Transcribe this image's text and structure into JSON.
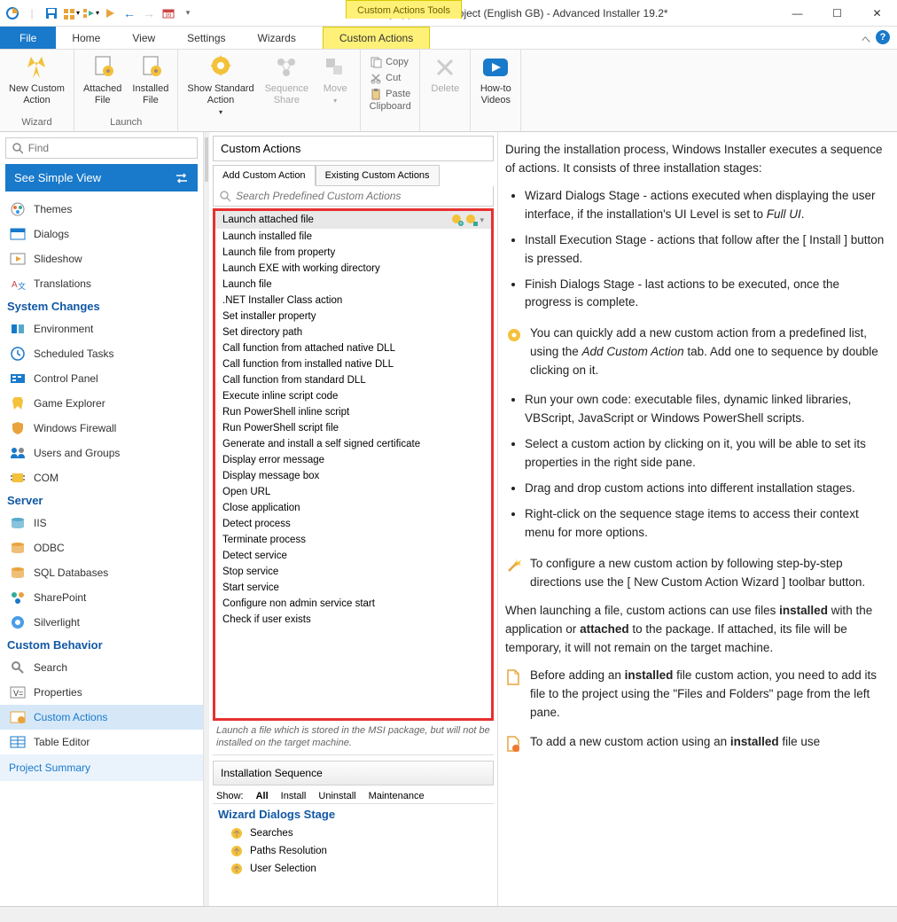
{
  "title": "MyApp - New Project (English GB) - Advanced Installer 19.2*",
  "contextTab": "Custom Actions Tools",
  "menu": {
    "file": "File",
    "home": "Home",
    "view": "View",
    "settings": "Settings",
    "wizards": "Wizards",
    "customActions": "Custom Actions"
  },
  "ribbon": {
    "wizard": {
      "label": "Wizard",
      "newCustom": "New Custom\nAction"
    },
    "launch": {
      "label": "Launch",
      "attached": "Attached\nFile",
      "installed": "Installed\nFile"
    },
    "standard": "Show Standard\nAction",
    "share": "Sequence\nShare",
    "move": "Move",
    "clipboard": {
      "label": "Clipboard",
      "copy": "Copy",
      "cut": "Cut",
      "paste": "Paste"
    },
    "delete": "Delete",
    "videos": "How-to\nVideos"
  },
  "find": {
    "placeholder": "Find"
  },
  "simpleView": "See Simple View",
  "nav": {
    "themes": "Themes",
    "dialogs": "Dialogs",
    "slideshow": "Slideshow",
    "translations": "Translations",
    "sysChanges": "System Changes",
    "environment": "Environment",
    "scheduled": "Scheduled Tasks",
    "controlPanel": "Control Panel",
    "gameExplorer": "Game Explorer",
    "firewall": "Windows Firewall",
    "usersGroups": "Users and Groups",
    "com": "COM",
    "server": "Server",
    "iis": "IIS",
    "odbc": "ODBC",
    "sql": "SQL Databases",
    "sharepoint": "SharePoint",
    "silverlight": "Silverlight",
    "customBehavior": "Custom Behavior",
    "search": "Search",
    "properties": "Properties",
    "customActions": "Custom Actions",
    "tableEditor": "Table Editor",
    "projectSummary": "Project Summary"
  },
  "panelHeader": "Custom Actions",
  "tabs": {
    "add": "Add Custom Action",
    "existing": "Existing Custom Actions"
  },
  "searchPlaceholder": "Search Predefined Custom Actions",
  "actions": [
    "Launch attached file",
    "Launch installed file",
    "Launch file from property",
    "Launch EXE with working directory",
    "Launch file",
    ".NET Installer Class action",
    "Set installer property",
    "Set directory path",
    "Call function from attached native DLL",
    "Call function from installed native DLL",
    "Call function from standard DLL",
    "Execute inline script code",
    "Run PowerShell inline script",
    "Run PowerShell script file",
    "Generate and install a self signed certificate",
    "Display error message",
    "Display message box",
    "Open URL",
    "Close application",
    "Detect process",
    "Terminate process",
    "Detect service",
    "Stop service",
    "Start service",
    "Configure non admin service start",
    "Check if user exists"
  ],
  "desc": "Launch a file which is stored in the MSI package, but will not be installed on the target machine.",
  "sequenceHeader": "Installation Sequence",
  "show": {
    "label": "Show:",
    "all": "All",
    "install": "Install",
    "uninstall": "Uninstall",
    "maintenance": "Maintenance"
  },
  "stage": {
    "header": "Wizard Dialogs Stage",
    "items": [
      "Searches",
      "Paths Resolution",
      "User Selection"
    ]
  },
  "help": {
    "p1": "During the installation process, Windows Installer executes a sequence of actions. It consists of three installation stages:",
    "li1a": "Wizard Dialogs Stage - actions executed when displaying the user interface, if the installation's UI Level is set to ",
    "li1b": "Full UI",
    "li2": "Install Execution Stage - actions that follow after the [ Install ] button is pressed.",
    "li3": "Finish Dialogs Stage - last actions to be executed, once the progress is complete.",
    "tip1a": "You can quickly add a new custom action from a predefined list, using the ",
    "tip1b": "Add Custom Action",
    "tip1c": " tab. Add one to sequence by double clicking on it.",
    "li4": "Run your own code: executable files, dynamic linked libraries, VBScript, JavaScript or Windows PowerShell scripts.",
    "li5": "Select a custom action by clicking on it, you will be able to set its properties in the right side pane.",
    "li6": "Drag and drop custom actions into different installation stages.",
    "li7": "Right-click on the sequence stage items to access their context menu for more options.",
    "tip2": "To configure a new custom action by following step-by-step directions use the [ New Custom Action Wizard ] toolbar button.",
    "p2a": "When launching a file, custom actions can use files ",
    "p2b": "installed",
    "p2c": " with the application or ",
    "p2d": "attached",
    "p2e": " to the package. If attached, its file will be temporary, it will not remain on the target machine.",
    "tip3a": "Before adding an ",
    "tip3b": "installed",
    "tip3c": " file custom action, you need to add its file to the project using the \"Files and Folders\" page from the left pane.",
    "tip4a": "To add a new custom action using an ",
    "tip4b": "installed",
    "tip4c": " file use"
  }
}
